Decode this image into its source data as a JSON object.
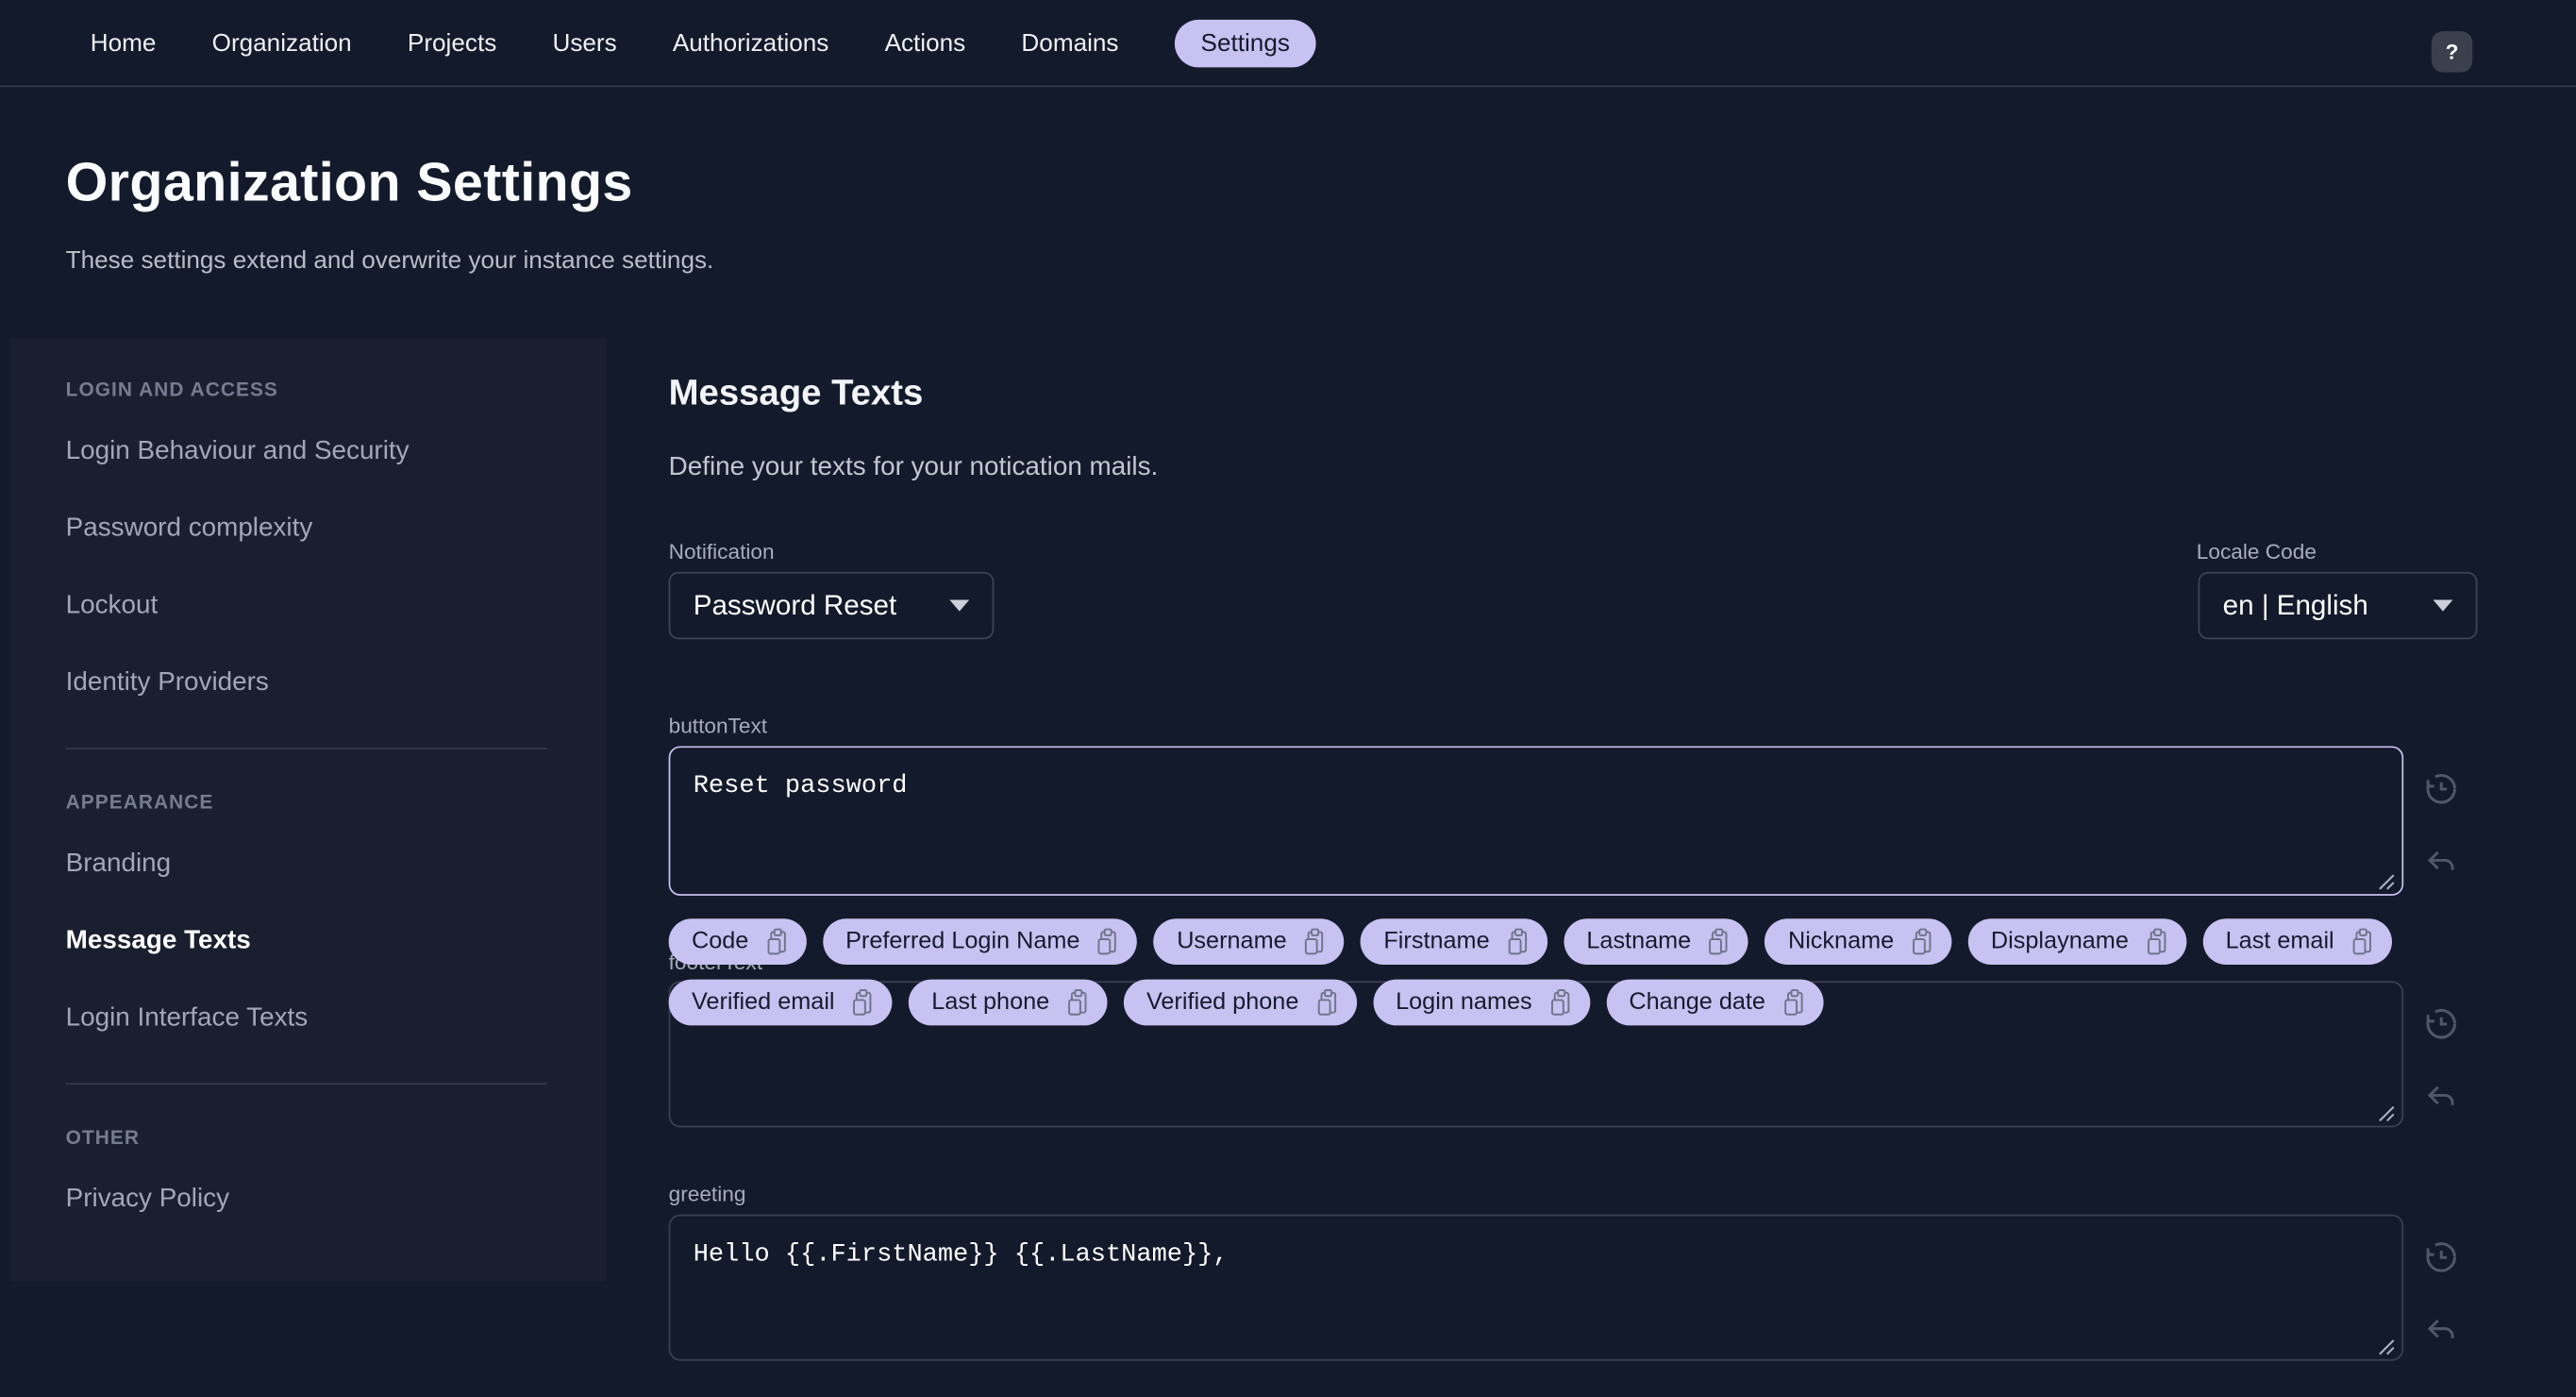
{
  "nav": {
    "items": [
      "Home",
      "Organization",
      "Projects",
      "Users",
      "Authorizations",
      "Actions",
      "Domains"
    ],
    "settings_label": "Settings",
    "help_label": "?"
  },
  "header": {
    "title": "Organization Settings",
    "subtitle": "These settings extend and overwrite your instance settings."
  },
  "sidebar": {
    "active_item": "Message Texts",
    "sections": [
      {
        "title": "LOGIN AND ACCESS",
        "items": [
          "Login Behaviour and Security",
          "Password complexity",
          "Lockout",
          "Identity Providers"
        ]
      },
      {
        "title": "APPEARANCE",
        "items": [
          "Branding",
          "Message Texts",
          "Login Interface Texts"
        ]
      },
      {
        "title": "OTHER",
        "items": [
          "Privacy Policy"
        ]
      }
    ]
  },
  "main": {
    "title": "Message Texts",
    "subtitle": "Define your texts for your notication mails.",
    "notification": {
      "label": "Notification",
      "value": "Password Reset"
    },
    "locale": {
      "label": "Locale Code",
      "value": "en | English"
    },
    "fields": {
      "button_text": {
        "label": "buttonText",
        "value": "Reset password"
      },
      "footer_text": {
        "label": "footerText",
        "value": ""
      },
      "greeting": {
        "label": "greeting",
        "value": "Hello {{.FirstName}} {{.LastName}},"
      }
    },
    "chips_row1": [
      "Code",
      "Preferred Login Name",
      "Username",
      "Firstname",
      "Lastname",
      "Nickname",
      "Displayname",
      "Last email"
    ],
    "chips_row2": [
      "Verified email",
      "Last phone",
      "Verified phone",
      "Login names",
      "Change date"
    ]
  },
  "colors": {
    "page_bg": "#131a2b",
    "sidebar_bg": "#1a1f30",
    "accent": "#c7c2f2",
    "input_border": "#3e4355",
    "muted_text": "#a7acbb"
  }
}
